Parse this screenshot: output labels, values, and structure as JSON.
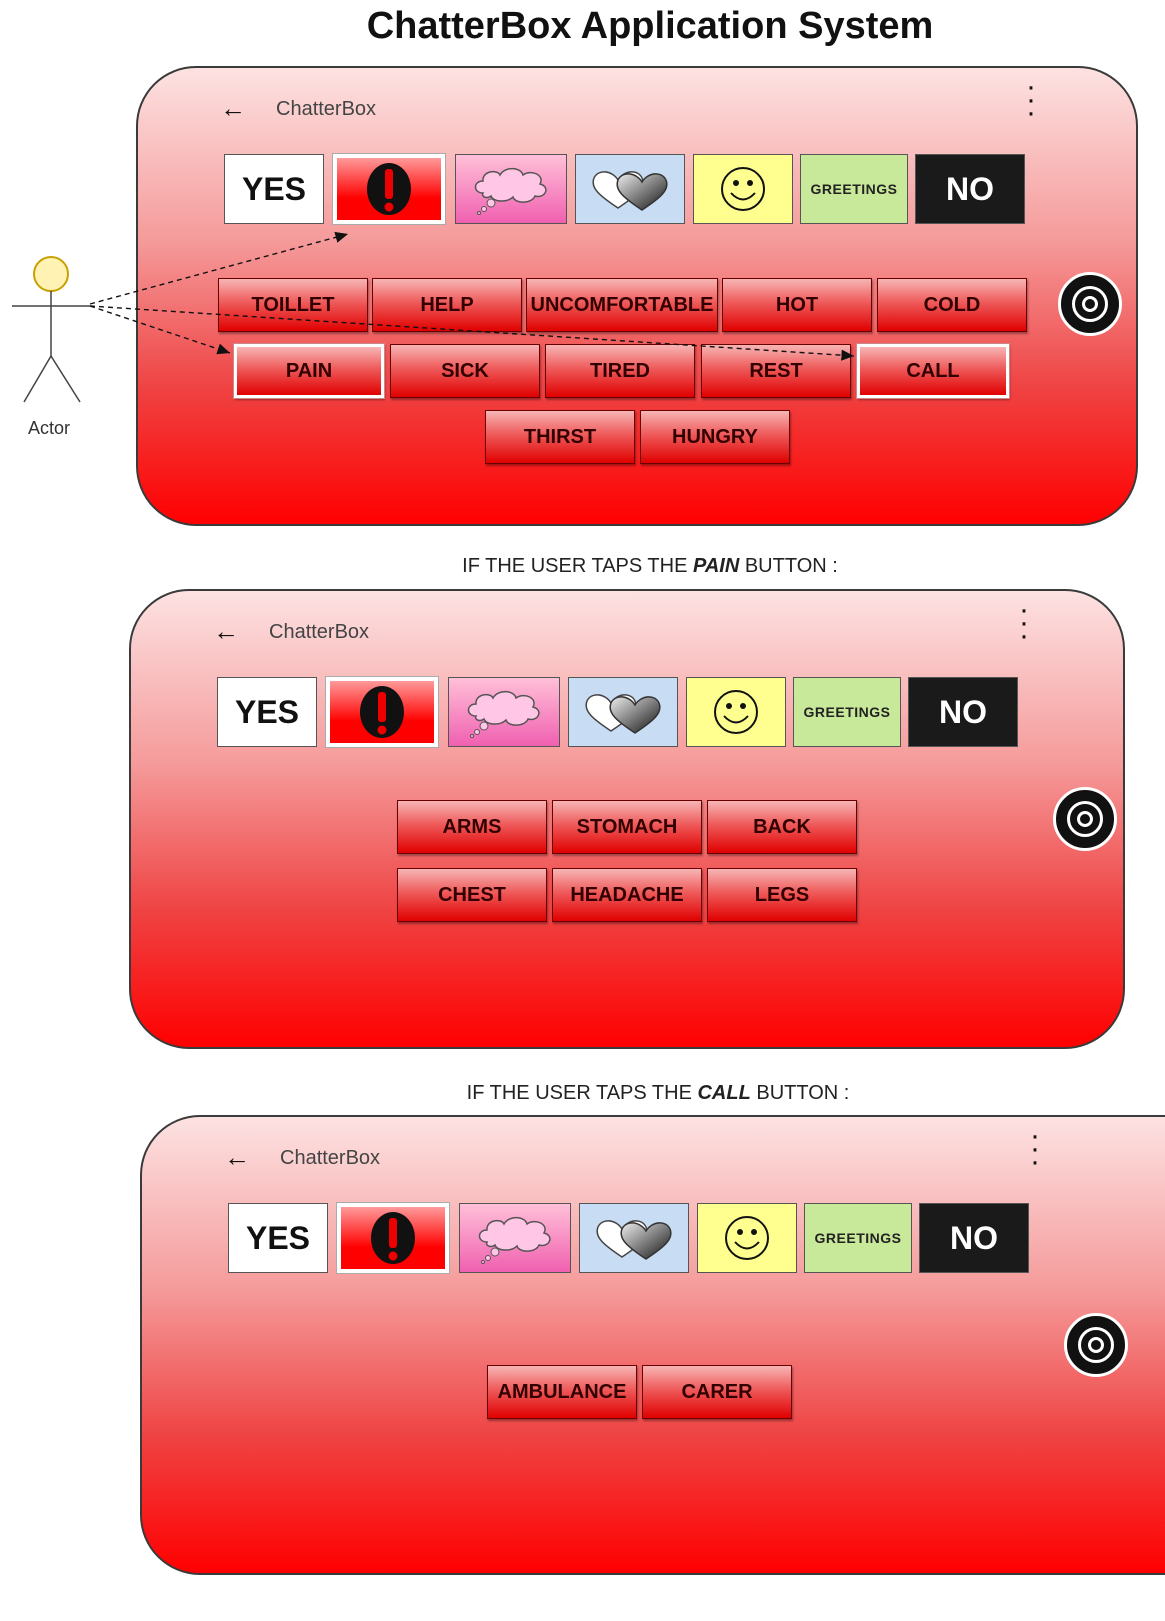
{
  "title": "ChatterBox Application System",
  "actor_label": "Actor",
  "captions": {
    "pain_prefix": "IF THE USER TAPS THE ",
    "pain_word": "PAIN",
    "pain_suffix": " BUTTON :",
    "call_prefix": "IF THE USER TAPS THE ",
    "call_word": "CALL",
    "call_suffix": " BUTTON :"
  },
  "app": {
    "name": "ChatterBox",
    "back_glyph": "←",
    "yes_label": "YES",
    "no_label": "NO",
    "greetings_label": "GREETINGS"
  },
  "icons": [
    "back-arrow-icon",
    "exclamation-icon",
    "thought-cloud-icon",
    "hearts-icon",
    "smiley-icon",
    "menu-kebab-icon",
    "camera-icon"
  ],
  "colors": {
    "phone_bottom": "#ff0000",
    "button_red": "#e00000",
    "no_tile": "#1a1a1a",
    "greetings_tile": "#c8e89a",
    "smile_tile": "#ffff90",
    "love_tile": "#c8dcf4"
  },
  "screen1": {
    "row1": [
      "TOILLET",
      "HELP",
      "UNCOMFORTABLE",
      "HOT",
      "COLD"
    ],
    "row2": [
      "PAIN",
      "SICK",
      "TIRED",
      "REST",
      "CALL"
    ],
    "row3": [
      "THIRST",
      "HUNGRY"
    ]
  },
  "screen2": {
    "row1": [
      "ARMS",
      "STOMACH",
      "BACK"
    ],
    "row2": [
      "CHEST",
      "HEADACHE",
      "LEGS"
    ]
  },
  "screen3": {
    "row1": [
      "AMBULANCE",
      "CARER"
    ]
  }
}
